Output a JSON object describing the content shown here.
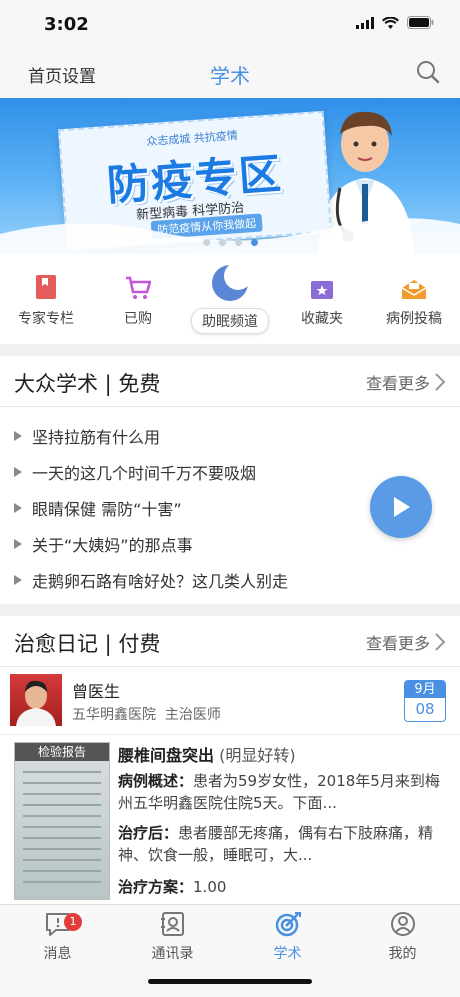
{
  "status_bar": {
    "time": "3:02"
  },
  "navbar": {
    "left": "首页设置",
    "title": "学术"
  },
  "banner": {
    "top_text": "众志成城 共抗疫情",
    "big_text": "防疫专区",
    "sub_text": "新型病毒 科学防治",
    "tag_text": "防范疫情从你我做起",
    "slide_count": 4,
    "active_slide": 3
  },
  "quick_menu": [
    {
      "label": "专家专栏",
      "icon": "book-icon"
    },
    {
      "label": "已购",
      "icon": "cart-icon"
    },
    {
      "label": "助眠频道",
      "icon": "moon-icon"
    },
    {
      "label": "收藏夹",
      "icon": "folder-star-icon"
    },
    {
      "label": "病例投稿",
      "icon": "envelope-icon"
    }
  ],
  "public_section": {
    "title": "大众学术 | 免费",
    "more": "查看更多",
    "articles": [
      "坚持拉筋有什么用",
      "一天的这几个时间千万不要吸烟",
      "眼睛保健 需防“十害”",
      "关于“大姨妈”的那点事",
      "走鹅卵石路有啥好处？这几类人别走"
    ]
  },
  "diary_section": {
    "title": "治愈日记 | 付费",
    "more": "查看更多",
    "doctor": {
      "name": "曾医生",
      "hospital": "五华明鑫医院",
      "role": "主治医师",
      "month": "9月",
      "day": "08"
    },
    "case": {
      "image_caption": "检验报告",
      "title": "腰椎间盘突出",
      "status": "(明显好转)",
      "summary_label": "病例概述：",
      "summary": "患者为59岁女性，2018年5月来到梅州五华明鑫医院住院5天。下面...",
      "after_label": "治疗后：",
      "after": "患者腰部无疼痛，偶有右下肢麻痛，精神、饮食一般，睡眠可，大...",
      "plan_label": "治疗方案：",
      "plan": "1.00"
    }
  },
  "tabbar": [
    {
      "label": "消息",
      "badge": "1"
    },
    {
      "label": "通讯录"
    },
    {
      "label": "学术"
    },
    {
      "label": "我的"
    }
  ],
  "colors": {
    "accent": "#4a90e2",
    "badge": "#e23c3c"
  }
}
